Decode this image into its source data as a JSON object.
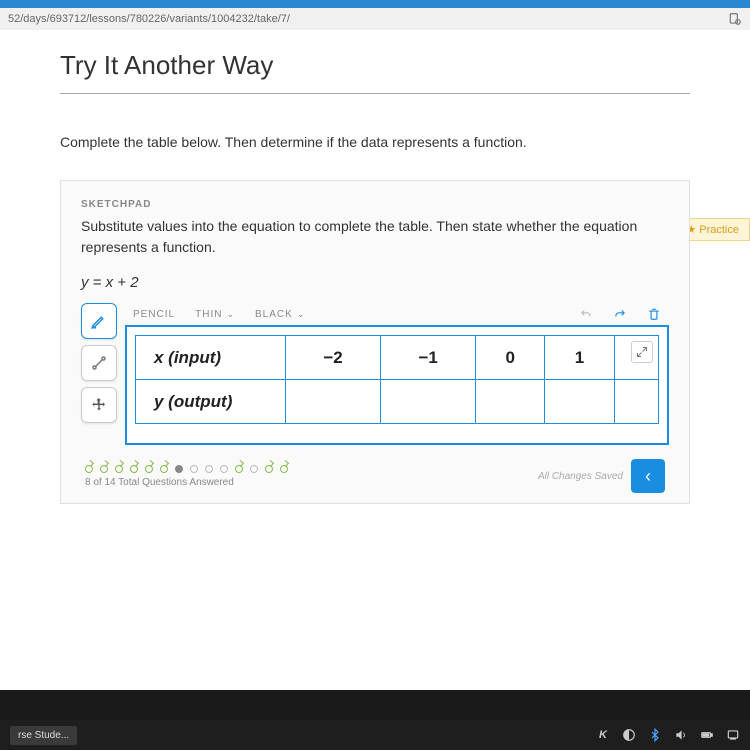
{
  "url": "52/days/693712/lessons/780226/variants/1004232/take/7/",
  "page": {
    "title": "Try It Another Way",
    "prompt": "Complete the table below. Then determine if the data represents a function.",
    "practice_badge": "Practice"
  },
  "sketchpad": {
    "label": "SKETCHPAD",
    "instruction": "Substitute values into the equation to complete the table. Then state whether the equation represents a function.",
    "equation": "y = x + 2",
    "toolbar": {
      "pencil": "PENCIL",
      "thin": "THIN",
      "black": "BLACK"
    },
    "table": {
      "row1_label": "x (input)",
      "row2_label": "y (output)",
      "cells": [
        "−2",
        "−1",
        "0",
        "1",
        ""
      ]
    }
  },
  "progress": {
    "text": "8 of 14 Total Questions Answered",
    "saved": "All Changes Saved"
  },
  "taskbar": {
    "item": "rse Stude..."
  }
}
